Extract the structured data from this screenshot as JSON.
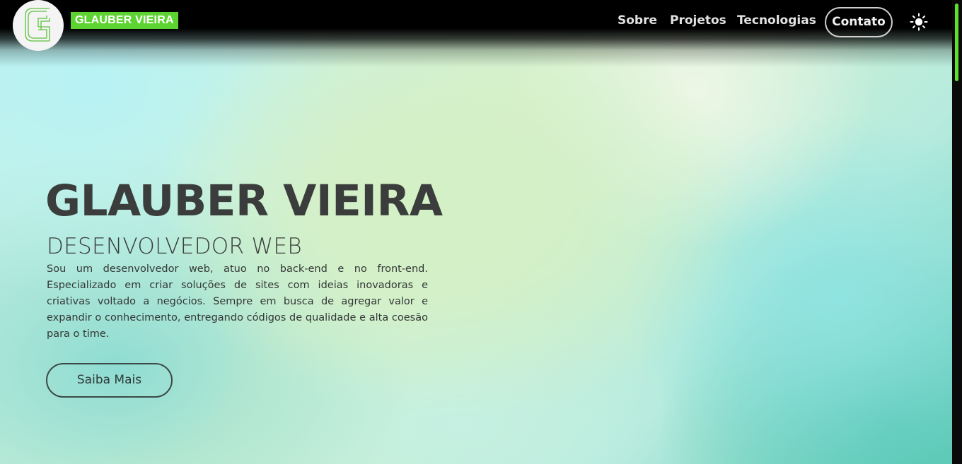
{
  "header": {
    "brand": "GLAUBER VIEIRA",
    "logo_icon": "g-monogram-logo",
    "nav": [
      {
        "label": "Sobre"
      },
      {
        "label": "Projetos"
      },
      {
        "label": "Tecnologias"
      }
    ],
    "contact_label": "Contato",
    "theme_icon": "sun-icon"
  },
  "hero": {
    "title": "GLAUBER VIEIRA",
    "subtitle": "DESENVOLVEDOR WEB",
    "description": "Sou um desenvolvedor web, atuo no back-end e no front-end. Especializado em criar soluções de sites com ideias inovadoras e criativas voltado a negócios. Sempre em busca de agregar valor e expandir o conhecimento, entregando códigos de qualidade e alta coesão para o time.",
    "cta_label": "Saiba Mais"
  },
  "colors": {
    "accent": "#5cd331",
    "header_bg": "#000000",
    "text_dark": "#3a3d3b"
  }
}
